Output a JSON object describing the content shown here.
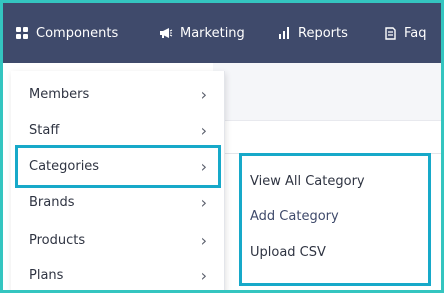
{
  "nav": {
    "items": [
      {
        "label": "Components",
        "icon": "grid-icon"
      },
      {
        "label": "Marketing",
        "icon": "megaphone-icon"
      },
      {
        "label": "Reports",
        "icon": "bar-chart-icon"
      },
      {
        "label": "Faq",
        "icon": "book-icon"
      }
    ]
  },
  "menu": {
    "items": [
      {
        "label": "Members"
      },
      {
        "label": "Staff"
      },
      {
        "label": "Categories"
      },
      {
        "label": "Brands"
      },
      {
        "label": "Products"
      },
      {
        "label": "Plans"
      }
    ],
    "chevron": "›",
    "active": "Categories"
  },
  "submenu": {
    "items": [
      {
        "label": "View All Category"
      },
      {
        "label": "Add Category"
      },
      {
        "label": "Upload CSV"
      }
    ]
  },
  "colors": {
    "nav_bg": "#3f4a6b",
    "accent": "#17a9c9",
    "frame": "#34c5c0",
    "text": "#2f3442"
  }
}
